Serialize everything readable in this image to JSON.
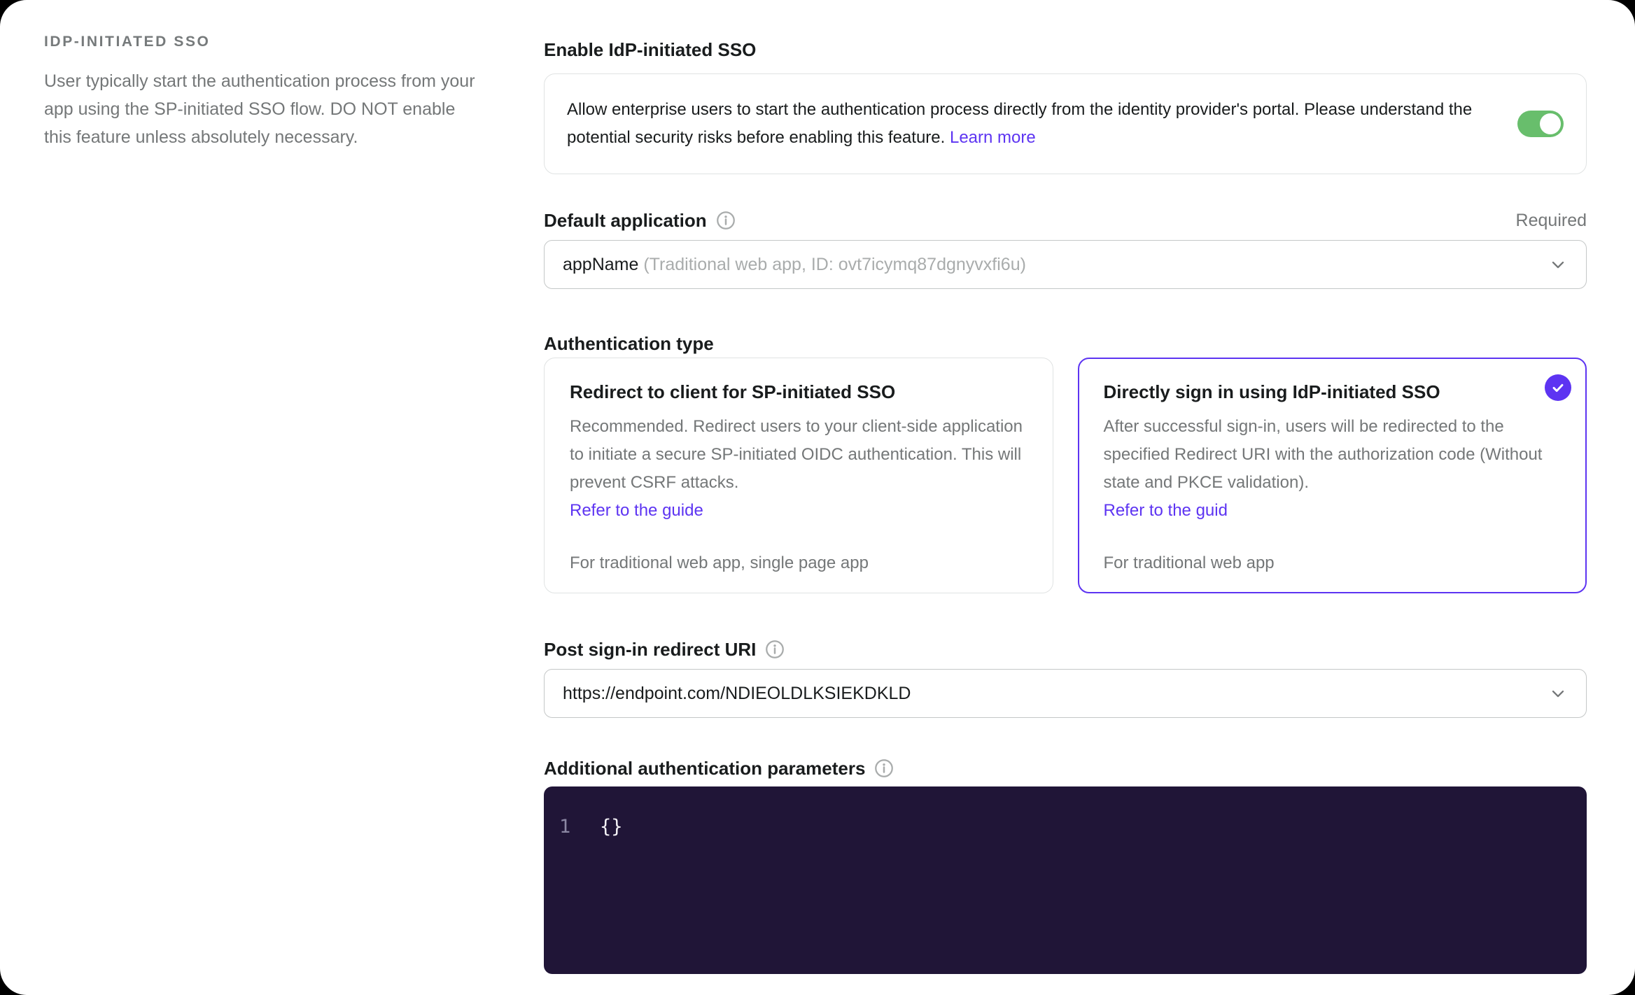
{
  "colors": {
    "accent_purple": "#5d34f2",
    "toggle_green": "#68be6c",
    "editor_bg": "#201537",
    "text_primary": "#191c1d",
    "text_secondary": "#747778"
  },
  "sidebar": {
    "title": "IDP-INITIATED SSO",
    "description": "User typically start the authentication process from your app using the SP-initiated SSO flow. DO NOT enable this feature unless absolutely necessary."
  },
  "form": {
    "enable_sso": {
      "label": "Enable IdP-initiated SSO",
      "description": "Allow enterprise users to start the authentication process directly from the identity provider's portal. Please understand the potential security risks before enabling this feature.",
      "link_label": "Learn more",
      "toggle_state": "on"
    },
    "default_application": {
      "label": "Default application",
      "required_badge": "Required",
      "value_primary": "appName",
      "value_secondary": "(Traditional web app, ID: ovt7icymq87dgnyvxfi6u)"
    },
    "authentication_type": {
      "label": "Authentication type",
      "options": [
        {
          "title": "Redirect to client for SP-initiated SSO",
          "description": "Recommended. Redirect users to your client-side application to initiate a secure SP-initiated OIDC authentication. This will prevent CSRF attacks.",
          "link_label": "Refer to the guide",
          "footnote": "For traditional web app, single page app",
          "selected": false
        },
        {
          "title": "Directly sign in using IdP-initiated SSO",
          "description": "After successful sign-in, users will be redirected to the specified Redirect URI with the authorization code (Without state and PKCE validation).",
          "link_label": "Refer to the guid",
          "footnote": "For traditional web app",
          "selected": true
        }
      ]
    },
    "redirect_uri": {
      "label": "Post sign-in redirect URI",
      "value": "https://endpoint.com/NDIEOLDLKSIEKDKLD"
    },
    "additional_params": {
      "label": "Additional authentication parameters",
      "editor": {
        "line_number": "1",
        "code": "{}"
      }
    }
  }
}
